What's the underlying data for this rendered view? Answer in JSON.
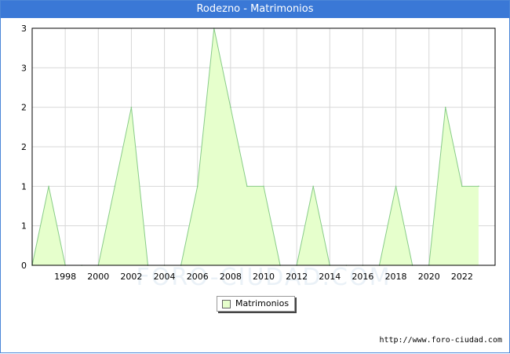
{
  "title": "Rodezno - Matrimonios",
  "watermark": "FORO-CIUDAD.COM",
  "source_url": "http://www.foro-ciudad.com",
  "colors": {
    "header": "#3a78d6",
    "fill": "#e6ffcc",
    "line": "#88cc88",
    "grid": "#d8d8d8"
  },
  "chart_data": {
    "type": "area",
    "title": "Rodezno - Matrimonios",
    "x": [
      1996,
      1997,
      1998,
      1999,
      2000,
      2001,
      2002,
      2003,
      2004,
      2005,
      2006,
      2007,
      2008,
      2009,
      2010,
      2011,
      2012,
      2013,
      2014,
      2015,
      2016,
      2017,
      2018,
      2019,
      2020,
      2021,
      2022,
      2023
    ],
    "series": [
      {
        "name": "Matrimonios",
        "values": [
          0,
          1,
          0,
          0,
          0,
          1,
          2,
          0,
          0,
          0,
          1,
          3,
          2,
          1,
          1,
          0,
          0,
          1,
          0,
          0,
          0,
          0,
          1,
          0,
          0,
          2,
          1,
          1
        ]
      }
    ],
    "x_ticks": [
      1998,
      2000,
      2002,
      2004,
      2006,
      2008,
      2010,
      2012,
      2014,
      2016,
      2018,
      2020,
      2022
    ],
    "y_ticks": [
      0,
      0.5,
      1,
      1.5,
      2,
      2.5,
      3
    ],
    "y_tick_labels": [
      "0",
      "1",
      "1",
      "2",
      "2",
      "3",
      "3"
    ],
    "ylim": [
      0,
      3
    ],
    "xlim": [
      1996,
      2024
    ],
    "grid": true,
    "legend_position": "bottom-center"
  }
}
